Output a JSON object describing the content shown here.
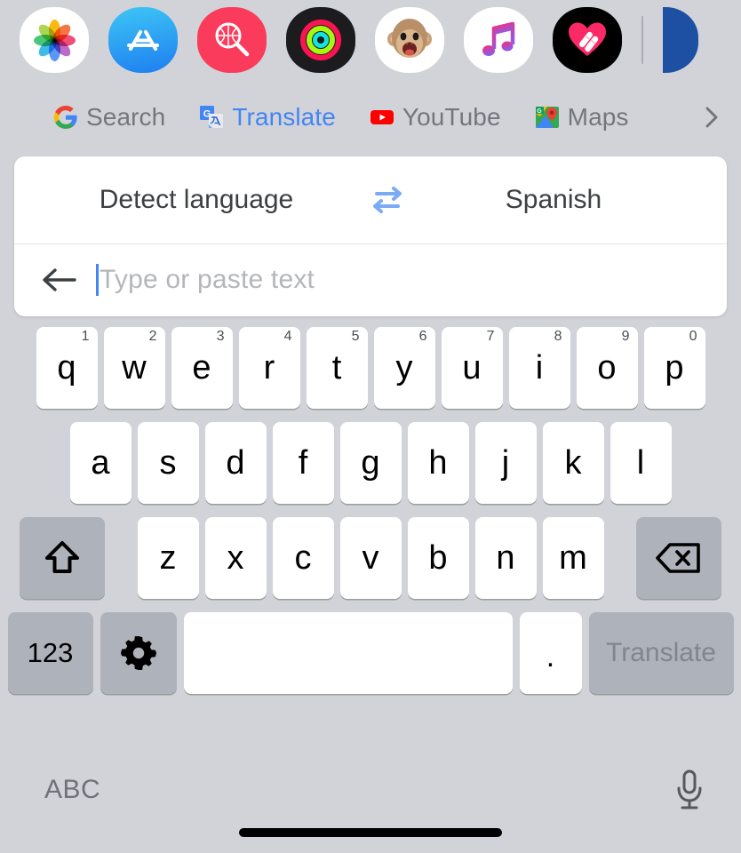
{
  "app_strip": {
    "icons": [
      {
        "name": "photos-app-icon",
        "label": "Photos"
      },
      {
        "name": "app-store-app-icon",
        "label": "App Store"
      },
      {
        "name": "images-app-icon",
        "label": "#images"
      },
      {
        "name": "fitness-app-icon",
        "label": "Activity"
      },
      {
        "name": "memoji-app-icon",
        "label": "Memoji"
      },
      {
        "name": "apple-music-app-icon",
        "label": "Music"
      },
      {
        "name": "digital-touch-app-icon",
        "label": "Digital Touch"
      }
    ],
    "divider": true,
    "partial_icon": {
      "name": "partial-blue-app-icon",
      "color": "#1d4fa3"
    }
  },
  "tabs": {
    "items": [
      {
        "label": "Search",
        "icon": "google-g-icon",
        "active": false
      },
      {
        "label": "Translate",
        "icon": "google-translate-icon",
        "active": true
      },
      {
        "label": "YouTube",
        "icon": "youtube-icon",
        "active": false
      },
      {
        "label": "Maps",
        "icon": "google-maps-icon",
        "active": false
      }
    ],
    "more_icon": "chevron-right-icon",
    "active_color": "#4285f4",
    "inactive_color": "#73777d"
  },
  "translate_card": {
    "source_language": "Detect language",
    "target_language": "Spanish",
    "swap_icon": "swap-horizontal-icon",
    "back_icon": "arrow-left-icon",
    "input_value": "",
    "input_placeholder": "Type or paste text",
    "caret_color": "#4285f4"
  },
  "keyboard": {
    "row1": [
      {
        "key": "q",
        "hint": "1"
      },
      {
        "key": "w",
        "hint": "2"
      },
      {
        "key": "e",
        "hint": "3"
      },
      {
        "key": "r",
        "hint": "4"
      },
      {
        "key": "t",
        "hint": "5"
      },
      {
        "key": "y",
        "hint": "6"
      },
      {
        "key": "u",
        "hint": "7"
      },
      {
        "key": "i",
        "hint": "8"
      },
      {
        "key": "o",
        "hint": "9"
      },
      {
        "key": "p",
        "hint": "0"
      }
    ],
    "row2": [
      {
        "key": "a"
      },
      {
        "key": "s"
      },
      {
        "key": "d"
      },
      {
        "key": "f"
      },
      {
        "key": "g"
      },
      {
        "key": "h"
      },
      {
        "key": "j"
      },
      {
        "key": "k"
      },
      {
        "key": "l"
      }
    ],
    "row3": {
      "shift": {
        "icon": "shift-icon",
        "label": ""
      },
      "letters": [
        {
          "key": "z"
        },
        {
          "key": "x"
        },
        {
          "key": "c"
        },
        {
          "key": "v"
        },
        {
          "key": "b"
        },
        {
          "key": "n"
        },
        {
          "key": "m"
        }
      ],
      "backspace": {
        "icon": "backspace-icon",
        "label": ""
      }
    },
    "row4": {
      "numeric": "123",
      "settings": {
        "icon": "gear-icon"
      },
      "space": "",
      "period": ".",
      "action": "Translate"
    },
    "key_bg": "#ffffff",
    "modifier_bg": "#aeb2bb"
  },
  "bottom_bar": {
    "abc_label": "ABC",
    "mic_icon": "microphone-icon"
  },
  "colors": {
    "background": "#d1d3d8",
    "accent": "#4285f4"
  }
}
